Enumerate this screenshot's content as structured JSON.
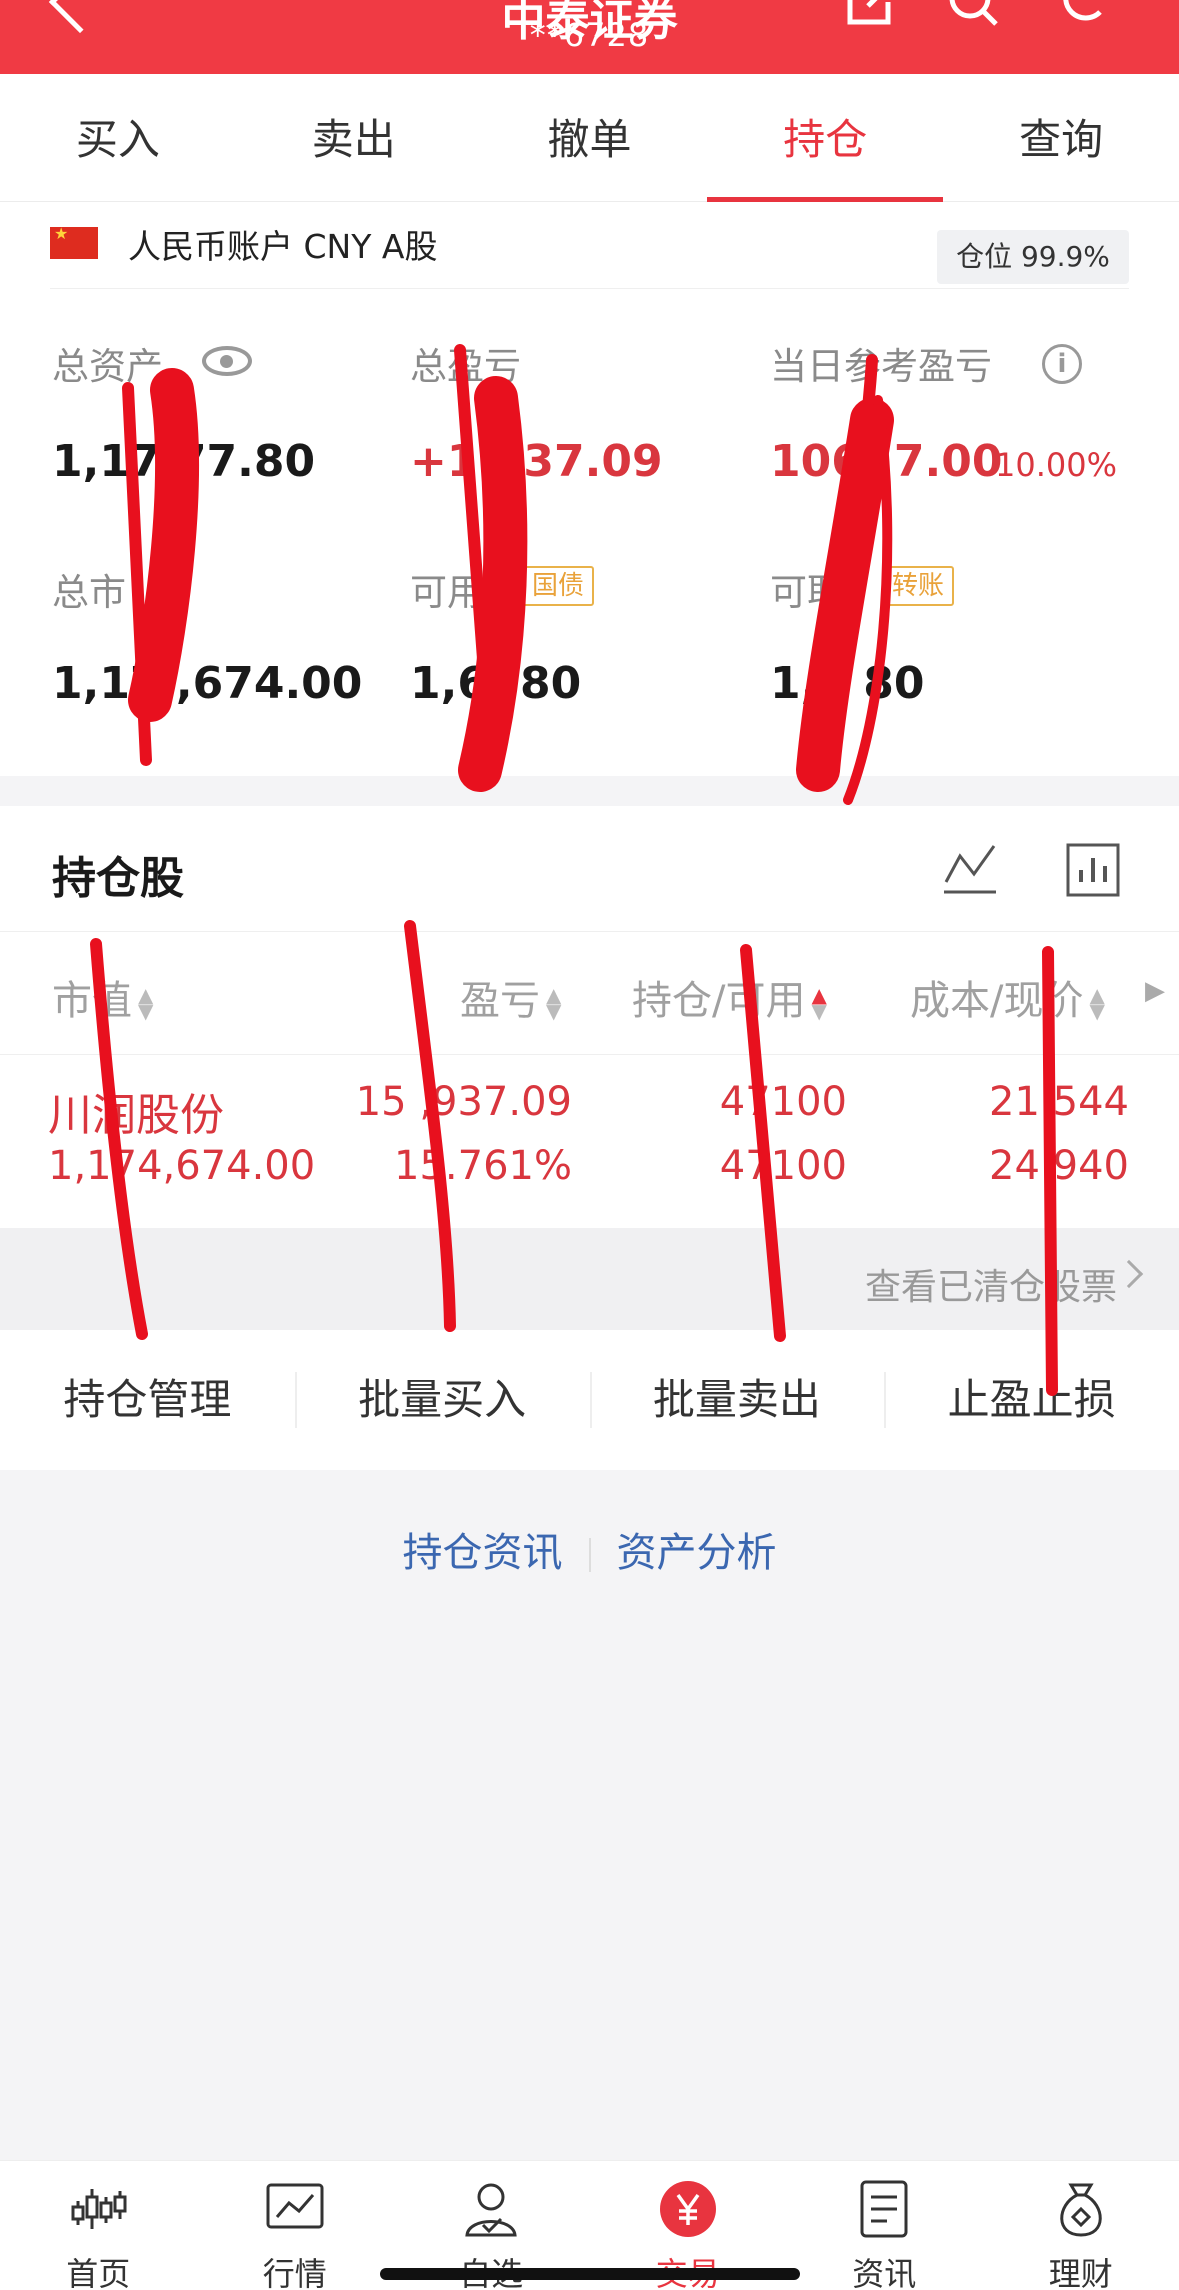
{
  "header": {
    "title": "中泰证券",
    "account": "**6728"
  },
  "tabs": [
    {
      "label": "买入"
    },
    {
      "label": "卖出"
    },
    {
      "label": "撤单"
    },
    {
      "label": "持仓"
    },
    {
      "label": "查询"
    }
  ],
  "active_tab": "持仓",
  "account_line": {
    "label": "人民币账户 CNY A股",
    "position_badge": "仓位 99.9%"
  },
  "stats": {
    "total_assets": {
      "label": "总资产",
      "value": "1,17   77.80"
    },
    "total_pnl": {
      "label": "总盈亏",
      "value": "+1   937.09"
    },
    "daily_pnl": {
      "label": "当日参考盈亏",
      "value": "106,  7.00",
      "pct": "10.00%"
    },
    "market_value": {
      "label": "总市",
      "value": "1,17 ,674.00"
    },
    "available": {
      "label": "可用",
      "tag": "国债",
      "value": "1,6  .80"
    },
    "withdrawable": {
      "label": "可取",
      "tag": "转账",
      "value": "1,6  80"
    }
  },
  "holdings": {
    "title": "持仓股",
    "columns": [
      "市值",
      "盈亏",
      "持仓/可用",
      "成本/现价"
    ],
    "rows": [
      {
        "name": "川润股份",
        "market_value": "1,174,674.00",
        "pnl": "15 ,937.09",
        "pnl_pct": "15.761%",
        "position": "47100",
        "available": "47100",
        "cost": "21 544",
        "price": "24 940"
      }
    ],
    "view_cleared": "查看已清仓股票"
  },
  "actions": [
    {
      "label": "持仓管理"
    },
    {
      "label": "批量买入"
    },
    {
      "label": "批量卖出"
    },
    {
      "label": "止盈止损"
    }
  ],
  "links": {
    "news": "持仓资讯",
    "analysis": "资产分析"
  },
  "nav": [
    {
      "label": "首页",
      "icon": "candlestick-icon"
    },
    {
      "label": "行情",
      "icon": "line-chart-icon"
    },
    {
      "label": "自选",
      "icon": "user-check-icon"
    },
    {
      "label": "交易",
      "icon": "yen-icon"
    },
    {
      "label": "资讯",
      "icon": "document-icon"
    },
    {
      "label": "理财",
      "icon": "money-bag-icon"
    }
  ],
  "colors": {
    "brand_red": "#f03a44",
    "link_blue": "#3b67b0",
    "tag_gold": "#e9a23a",
    "marker_red": "#e8101e"
  }
}
